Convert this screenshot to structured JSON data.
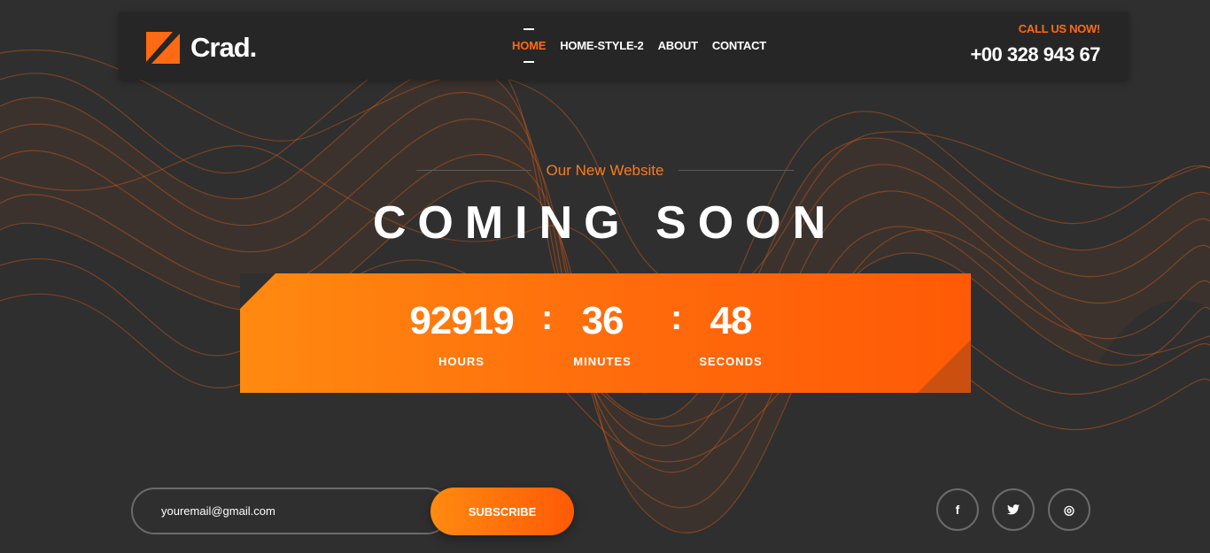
{
  "brand": {
    "name": "Crad."
  },
  "nav": {
    "items": [
      {
        "label": "HOME",
        "active": true
      },
      {
        "label": "HOME-STYLE-2",
        "active": false
      },
      {
        "label": "ABOUT",
        "active": false
      },
      {
        "label": "CONTACT",
        "active": false
      }
    ]
  },
  "contact": {
    "call_label": "CALL US NOW!",
    "phone": "+00 328 943 67"
  },
  "hero": {
    "subtitle": "Our New Website",
    "title": "COMING SOON"
  },
  "countdown": {
    "hours": {
      "value": "92919",
      "label": "HOURS"
    },
    "minutes": {
      "value": "36",
      "label": "MINUTES"
    },
    "seconds": {
      "value": "48",
      "label": "SECONDS"
    },
    "separator": ":"
  },
  "subscribe": {
    "placeholder": "youremail@gmail.com",
    "button_label": "SUBSCRIBE"
  },
  "social": [
    {
      "icon": "facebook-icon",
      "glyph": "f"
    },
    {
      "icon": "twitter-icon",
      "glyph": "t"
    },
    {
      "icon": "dribbble-icon",
      "glyph": "◎"
    }
  ],
  "colors": {
    "accent": "#ff6a13",
    "background": "#2f2f2f",
    "header": "#262626"
  }
}
